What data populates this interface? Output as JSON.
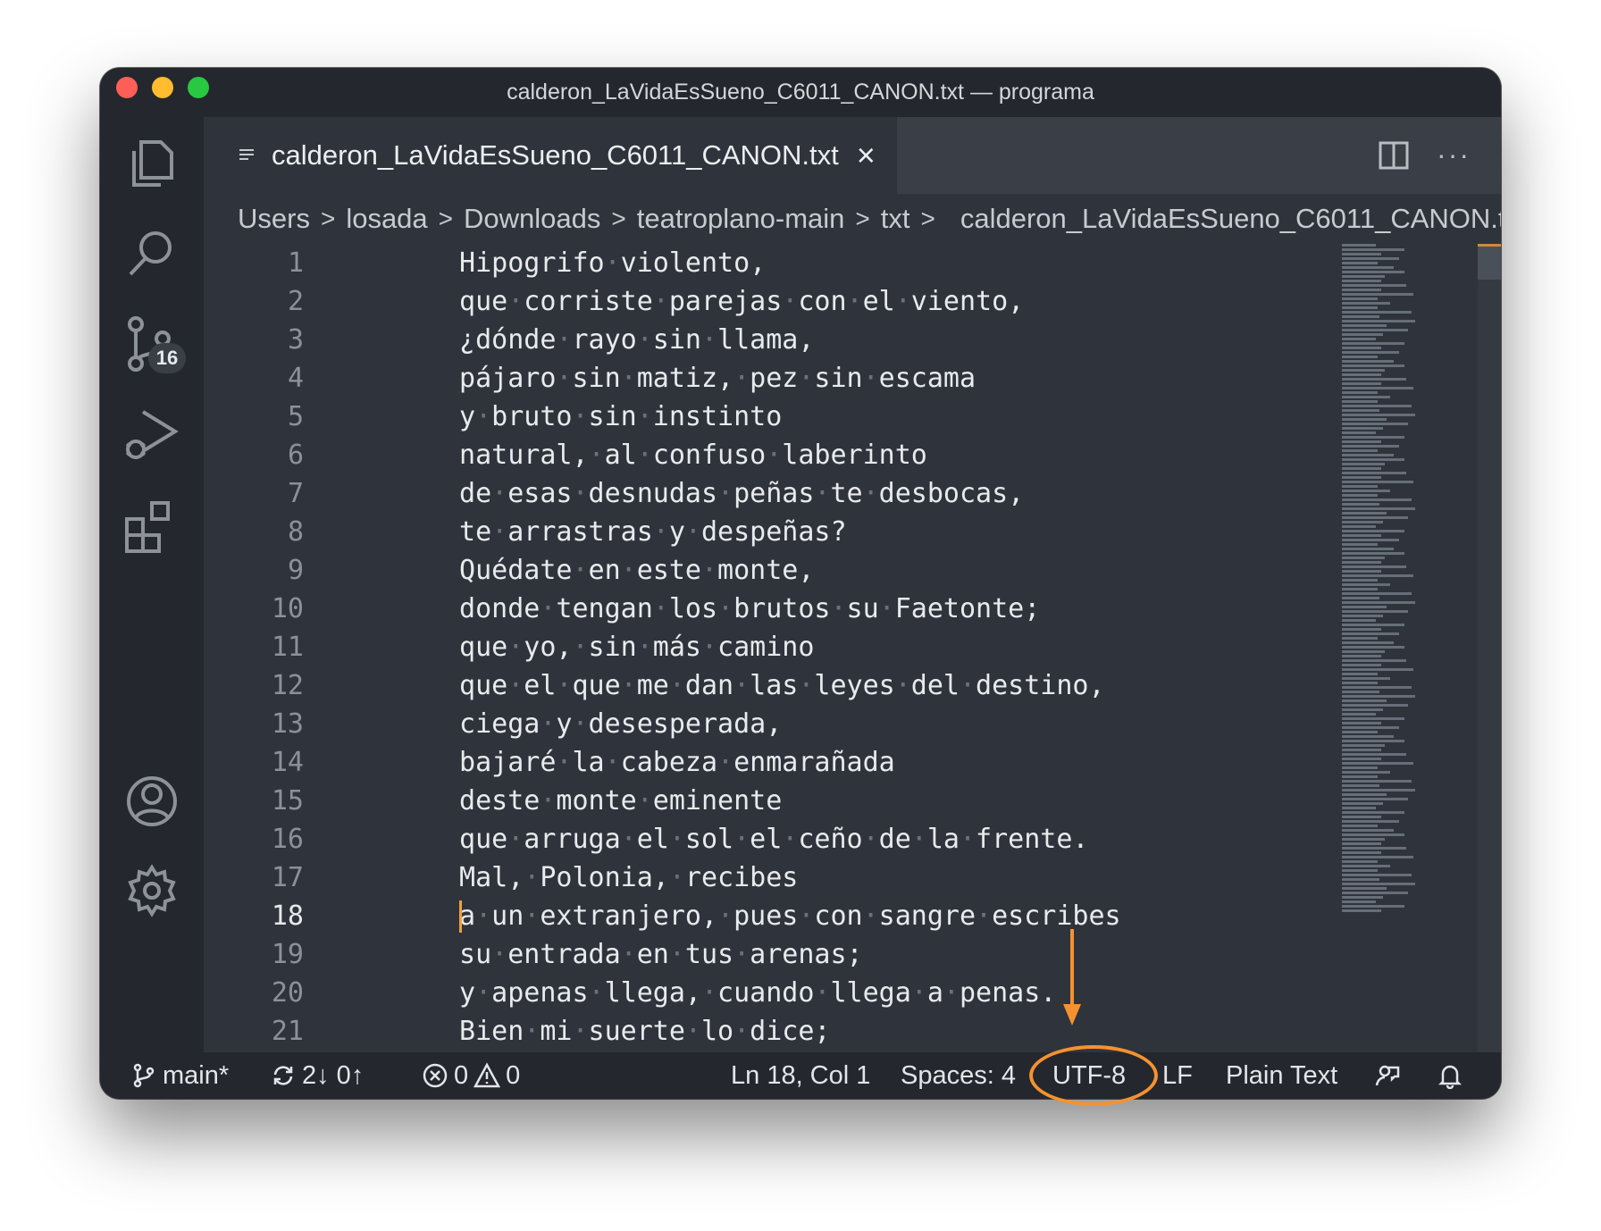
{
  "window": {
    "title": "calderon_LaVidaEsSueno_C6011_CANON.txt — programa"
  },
  "activity_bar": {
    "source_control_badge": "16"
  },
  "tab": {
    "label": "calderon_LaVidaEsSueno_C6011_CANON.txt",
    "close": "×",
    "more_actions": "···"
  },
  "breadcrumb": [
    "Users",
    "losada",
    "Downloads",
    "teatroplano-main",
    "txt",
    "calderon_LaVidaEsSueno_C6011_CANON.txt"
  ],
  "editor": {
    "active_line": 18,
    "lines": [
      "Hipogrifo violento,",
      "que corriste parejas con el viento,",
      "¿dónde rayo sin llama,",
      "pájaro sin matiz, pez sin escama",
      "y bruto sin instinto",
      "natural, al confuso laberinto",
      "de esas desnudas peñas te desbocas,",
      "te arrastras y despeñas?",
      "Quédate en este monte,",
      "donde tengan los brutos su Faetonte;",
      "que yo, sin más camino",
      "que el que me dan las leyes del destino,",
      "ciega y desesperada,",
      "bajaré la cabeza enmarañada",
      "deste monte eminente",
      "que arruga el sol el ceño de la frente.",
      "Mal, Polonia, recibes",
      "a un extranjero, pues con sangre escribes",
      "su entrada en tus arenas;",
      "y apenas llega, cuando llega a penas.",
      "Bien mi suerte lo dice;"
    ]
  },
  "statusbar": {
    "branch": "main*",
    "sync": "2↓ 0↑",
    "errors": "0",
    "warnings": "0",
    "position": "Ln 18, Col 1",
    "indent": "Spaces: 4",
    "encoding": "UTF-8",
    "eol": "LF",
    "language": "Plain Text"
  },
  "colors": {
    "annotation": "#f5922f",
    "background": "#2f343c",
    "chrome": "#24272d"
  }
}
